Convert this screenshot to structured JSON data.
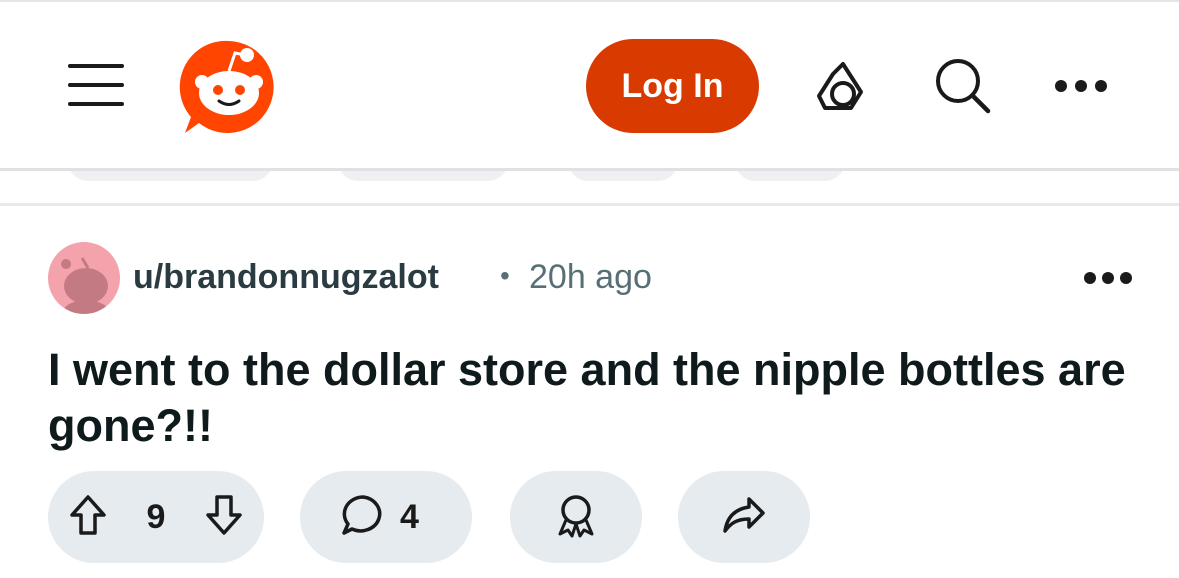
{
  "header": {
    "menu_icon": "hamburger-icon",
    "logo_icon": "reddit-logo-icon",
    "login_label": "Log In",
    "get_app_icon": "get-app-icon",
    "search_icon": "search-icon",
    "more_icon": "more-icon"
  },
  "post": {
    "username": "u/brandonnugzalot",
    "separator": "•",
    "time": "20h ago",
    "title": "I went to the dollar store and the nipple bottles are gone?!!",
    "votes": "9",
    "comments": "4"
  },
  "colors": {
    "brand": "#d93a00",
    "pill_bg": "#e5ebee",
    "avatar_bg": "#f4a3ad"
  }
}
